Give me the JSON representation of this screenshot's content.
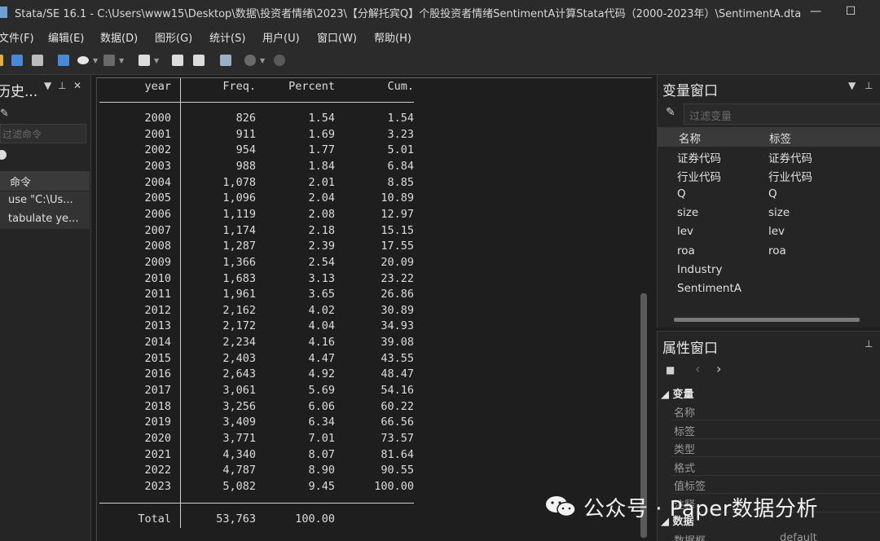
{
  "window": {
    "title": "Stata/SE 16.1 - C:\\Users\\www15\\Desktop\\数据\\投资者情绪\\2023\\【分解托宾Q】个股投资者情绪SentimentA计算Stata代码（2000-2023年）\\SentimentA.dta",
    "minimize": "—",
    "maximize": "☐",
    "close": "✕"
  },
  "menu": {
    "items": [
      "文件(F)",
      "编辑(E)",
      "数据(D)",
      "图形(G)",
      "统计(S)",
      "用户(U)",
      "窗口(W)",
      "帮助(H)"
    ]
  },
  "history": {
    "title": "历史...",
    "filter_placeholder": "过滤命令",
    "column_header": "命令",
    "items": [
      "use \"C:\\Us...",
      "tabulate ye..."
    ]
  },
  "results": {
    "headers": [
      "year",
      "Freq.",
      "Percent",
      "Cum."
    ],
    "rows": [
      [
        "2000",
        "826",
        "1.54",
        "1.54"
      ],
      [
        "2001",
        "911",
        "1.69",
        "3.23"
      ],
      [
        "2002",
        "954",
        "1.77",
        "5.01"
      ],
      [
        "2003",
        "988",
        "1.84",
        "6.84"
      ],
      [
        "2004",
        "1,078",
        "2.01",
        "8.85"
      ],
      [
        "2005",
        "1,096",
        "2.04",
        "10.89"
      ],
      [
        "2006",
        "1,119",
        "2.08",
        "12.97"
      ],
      [
        "2007",
        "1,174",
        "2.18",
        "15.15"
      ],
      [
        "2008",
        "1,287",
        "2.39",
        "17.55"
      ],
      [
        "2009",
        "1,366",
        "2.54",
        "20.09"
      ],
      [
        "2010",
        "1,683",
        "3.13",
        "23.22"
      ],
      [
        "2011",
        "1,961",
        "3.65",
        "26.86"
      ],
      [
        "2012",
        "2,162",
        "4.02",
        "30.89"
      ],
      [
        "2013",
        "2,172",
        "4.04",
        "34.93"
      ],
      [
        "2014",
        "2,234",
        "4.16",
        "39.08"
      ],
      [
        "2015",
        "2,403",
        "4.47",
        "43.55"
      ],
      [
        "2016",
        "2,643",
        "4.92",
        "48.47"
      ],
      [
        "2017",
        "3,061",
        "5.69",
        "54.16"
      ],
      [
        "2018",
        "3,256",
        "6.06",
        "60.22"
      ],
      [
        "2019",
        "3,409",
        "6.34",
        "66.56"
      ],
      [
        "2020",
        "3,771",
        "7.01",
        "73.57"
      ],
      [
        "2021",
        "4,340",
        "8.07",
        "81.64"
      ],
      [
        "2022",
        "4,787",
        "8.90",
        "90.55"
      ],
      [
        "2023",
        "5,082",
        "9.45",
        "100.00"
      ]
    ],
    "total": [
      "Total",
      "53,763",
      "100.00",
      ""
    ]
  },
  "variables": {
    "title": "变量窗口",
    "filter_placeholder": "过滤变量",
    "col_name": "名称",
    "col_label": "标签",
    "items": [
      {
        "name": "证券代码",
        "label": "证券代码"
      },
      {
        "name": "行业代码",
        "label": "行业代码"
      },
      {
        "name": "Q",
        "label": "Q"
      },
      {
        "name": "size",
        "label": "size"
      },
      {
        "name": "lev",
        "label": "lev"
      },
      {
        "name": "roa",
        "label": "roa"
      },
      {
        "name": "Industry",
        "label": ""
      },
      {
        "name": "SentimentA",
        "label": ""
      }
    ]
  },
  "properties": {
    "title": "属性窗口",
    "group_variable": "变量",
    "fields": [
      "名称",
      "标签",
      "类型",
      "格式",
      "值标签",
      "注释"
    ],
    "group_data": "数据",
    "data_fields": [
      {
        "label": "数据框",
        "value": "default"
      }
    ]
  },
  "watermark": {
    "text": "公众号 · Paper数据分析"
  }
}
